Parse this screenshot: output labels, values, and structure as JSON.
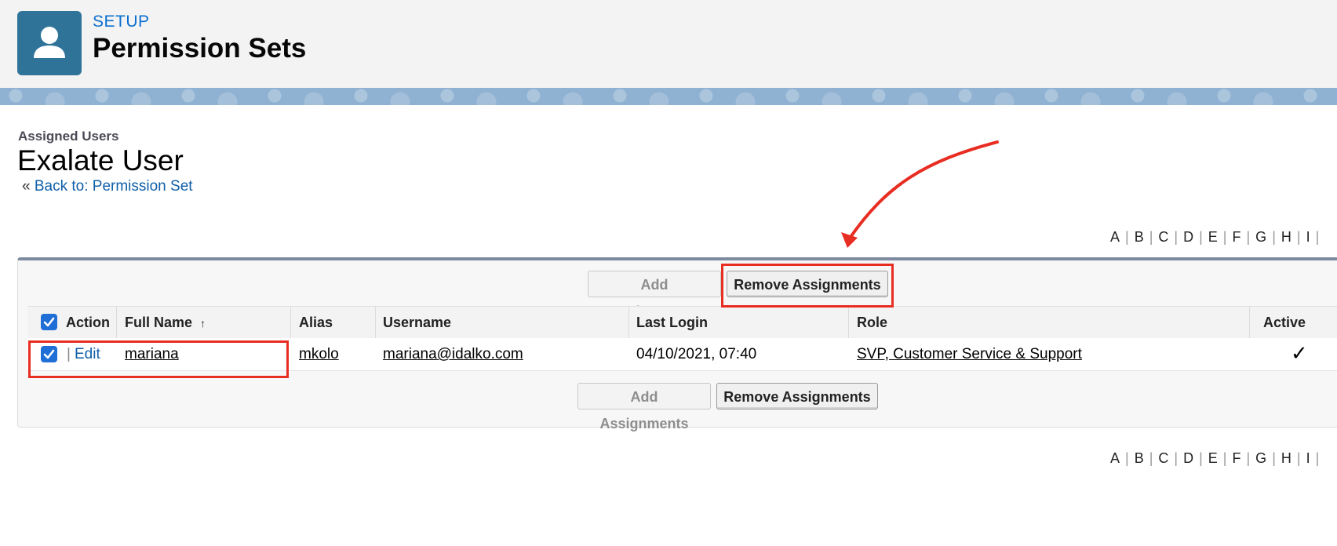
{
  "header": {
    "setup_label": "SETUP",
    "title": "Permission Sets",
    "icon": "user-icon"
  },
  "page": {
    "section_label": "Assigned Users",
    "title": "Exalate User",
    "back_prefix": "«",
    "back_link": "Back to: Permission Set"
  },
  "alpha_index": [
    "A",
    "B",
    "C",
    "D",
    "E",
    "F",
    "G",
    "H",
    "I"
  ],
  "buttons": {
    "add": "Add Assignments",
    "remove": "Remove Assignments"
  },
  "table": {
    "columns": {
      "action": "Action",
      "full_name": "Full Name",
      "alias": "Alias",
      "username": "Username",
      "last_login": "Last Login",
      "role": "Role",
      "active": "Active"
    },
    "sort_indicator": "↑",
    "rows": [
      {
        "checked": true,
        "separator": "|",
        "action": "Edit",
        "full_name": "mariana",
        "alias": "mkolo",
        "username": "mariana@idalko.com",
        "last_login": "04/10/2021, 07:40",
        "role": "SVP, Customer Service & Support",
        "active_mark": "✓"
      }
    ]
  },
  "colors": {
    "accent": "#0c6fd0",
    "header_icon": "#2f7399",
    "annotation": "#e82d22",
    "checkbox": "#1f6fd6"
  }
}
